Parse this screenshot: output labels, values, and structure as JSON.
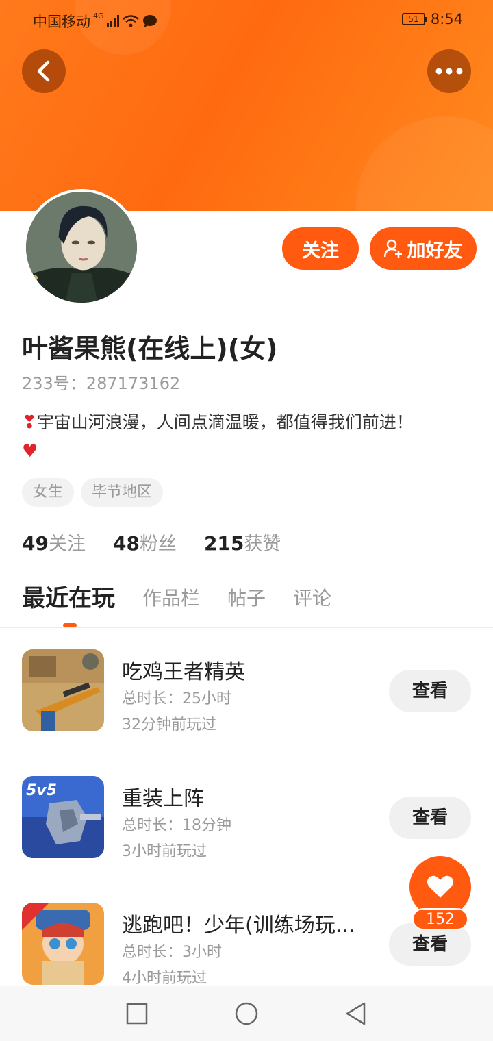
{
  "status_bar": {
    "carrier": "中国移动",
    "network": "4G",
    "battery": "51",
    "time": "8:54"
  },
  "header": {
    "back_icon": "chevron-left-icon",
    "more_icon": "more-dots-icon"
  },
  "actions": {
    "follow_label": "关注",
    "add_friend_label": "加好友",
    "add_friend_icon": "add-user-icon"
  },
  "profile": {
    "username": "叶酱果熊(在线上)(女)",
    "uid": "233号：287173162",
    "bio": "宇宙山河浪漫，人间点滴温暖，都值得我们前进！",
    "tags": [
      "女生",
      "毕节地区"
    ],
    "stats": [
      {
        "count": "49",
        "label": "关注"
      },
      {
        "count": "48",
        "label": "粉丝"
      },
      {
        "count": "215",
        "label": "获赞"
      }
    ]
  },
  "tabs": [
    "最近在玩",
    "作品栏",
    "帖子",
    "评论"
  ],
  "games": [
    {
      "name": "吃鸡王者精英",
      "duration": "总时长：25小时",
      "last_played": "32分钟前玩过",
      "button": "查看"
    },
    {
      "name": "重装上阵",
      "duration": "总时长：18分钟",
      "last_played": "3小时前玩过",
      "button": "查看"
    },
    {
      "name": "逃跑吧！少年(训练场玩...",
      "duration": "总时长：3小时",
      "last_played": "4小时前玩过",
      "button": "查看"
    }
  ],
  "like": {
    "count": "152",
    "icon": "heart-icon"
  },
  "colors": {
    "accent": "#ff5a0f",
    "header": "#ff7a1c"
  }
}
